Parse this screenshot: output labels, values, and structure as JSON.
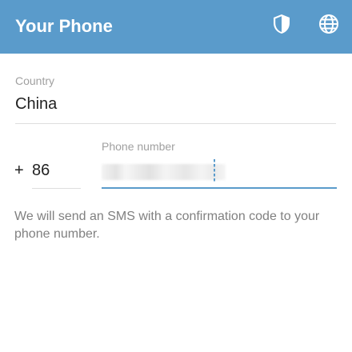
{
  "toolbar": {
    "title": "Your Phone",
    "background_color": "#5a9bcb",
    "actions": [
      {
        "icon": "shield-icon"
      },
      {
        "icon": "globe-icon"
      }
    ]
  },
  "form": {
    "country": {
      "label": "Country",
      "value": "China"
    },
    "phone": {
      "plus": "+",
      "country_code": "86",
      "label": "Phone number",
      "value_obscured": true
    }
  },
  "info": {
    "text": "We will send an SMS with a confirmation code to your phone number."
  },
  "colors": {
    "accent": "#5a9bcb",
    "hint": "#a0a0a0",
    "body_text": "#222222",
    "info_text": "#808080"
  }
}
